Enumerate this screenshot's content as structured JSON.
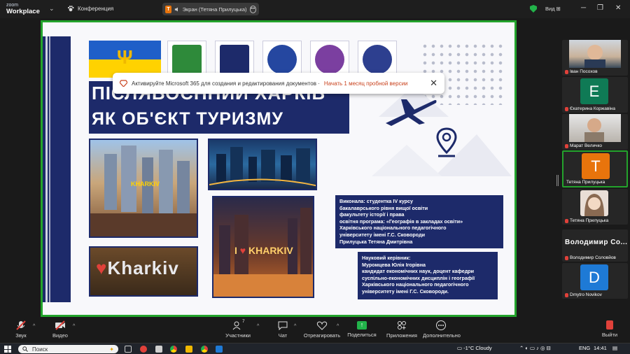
{
  "app": {
    "logo_top": "zoom",
    "logo_bottom": "Workplace",
    "conference_label": "Конференция"
  },
  "screen_share": {
    "label": "Экран (Тетяна Прилуцька)",
    "presenter_initial": "T"
  },
  "view": {
    "label": "Вид"
  },
  "slide": {
    "title_line1": "ПІСЛЯВОЄННИЙ ХАРКІВ",
    "title_line2": "ЯК ОБ'ЄКТ ТУРИЗМУ",
    "photo_text_1": "KHARKIV",
    "photo_text_2": "KHARKIV",
    "photo_text_3": "Kharkiv",
    "author": [
      "Виконала: студентка IV курсу",
      "бакалаврського рівня вищої освіти",
      "факультету історії і права",
      "освітня програма: «Географія в закладах освіти»",
      "Харківського національного педагогічного",
      "університету імені Г.С. Сковороди",
      "Прилуцька Тетяна Дмитрівна"
    ],
    "supervisor": [
      "Науковий керівник:",
      "Муромцева Юлія Ігорівна",
      "кандидат економічних наук,  доцент кафедри",
      "суспільно-економічних дисциплін і географії",
      "Харківського національного педагогічного",
      "університету імені Г.С. Сковороди."
    ]
  },
  "notification": {
    "text": "Активируйте Microsoft 365 для создания и редактирования документов · ",
    "link": "Начать 1 месяц пробной версии"
  },
  "participants": [
    {
      "name": "Іван Посохов",
      "type": "photo"
    },
    {
      "name": "Єкатерина Коржавіна",
      "type": "letter",
      "letter": "Е",
      "color": "#0f7a55"
    },
    {
      "name": "Марат Величко",
      "type": "photo"
    },
    {
      "name": "Тетяна Прилуцька",
      "type": "letter",
      "letter": "T",
      "color": "#e8740c"
    },
    {
      "name": "Тетяна Прилуцька",
      "type": "photo"
    },
    {
      "name": "Володимир Соловйов",
      "type": "bold"
    },
    {
      "name": "Dmytro Novikov",
      "type": "letter",
      "letter": "D",
      "color": "#1e7ad6"
    }
  ],
  "bold_name": "Володимир  Со...",
  "toolbar": {
    "audio": "Звук",
    "video": "Видео",
    "participants": "Участники",
    "participants_count": "7",
    "chat": "Чат",
    "react": "Отреагировать",
    "share": "Поделиться",
    "apps": "Приложения",
    "more": "Дополнительно",
    "leave": "Выйти"
  },
  "taskbar": {
    "search": "Поиск",
    "weather": "-1°C  Cloudy",
    "lang": "ENG",
    "time": "14:41"
  },
  "colors": {
    "accent_green": "#23a32c",
    "slide_navy": "#1d2a6a",
    "alert_red": "#e0413a"
  }
}
